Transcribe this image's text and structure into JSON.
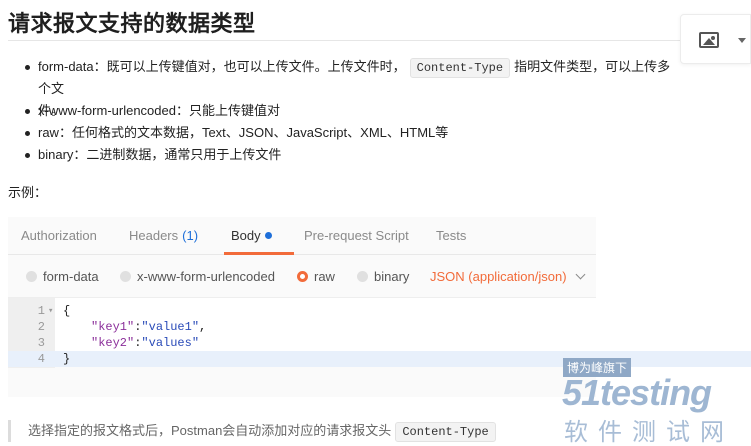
{
  "heading": "请求报文支持的数据类型",
  "bullets": {
    "b1_text1": "form-data：既可以上传键值对，也可以上传文件。上传文件时，",
    "b1_code": "Content-Type",
    "b1_text2": "指明文件类型，可以上传多个文",
    "b1_text3": "件。",
    "b2": "x-www-form-urlencoded：只能上传键值对",
    "b3": "raw：任何格式的文本数据，Text、JSON、JavaScript、XML、HTML等",
    "b4": "binary：二进制数据，通常只用于上传文件"
  },
  "example_label": "示例：",
  "postman": {
    "tabs": {
      "authorization": "Authorization",
      "headers": "Headers",
      "headers_count": "(1)",
      "body": "Body",
      "prerequest": "Pre-request Script",
      "tests": "Tests"
    },
    "body_types": {
      "form_data": "form-data",
      "urlencoded": "x-www-form-urlencoded",
      "raw": "raw",
      "binary": "binary"
    },
    "content_type": "JSON (application/json)",
    "editor": {
      "ln1": "1",
      "ln2": "2",
      "ln3": "3",
      "ln4": "4",
      "l1": "{",
      "l2_key": "\"key1\"",
      "l2_colon": ":",
      "l2_val": "\"value1\"",
      "l2_tail": ",",
      "l3_key": "\"key2\"",
      "l3_colon": ":",
      "l3_val": "\"values\"",
      "l4": "}"
    }
  },
  "note": {
    "text": "选择指定的报文格式后，Postman会自动添加对应的请求报文头",
    "code": "Content-Type"
  },
  "watermark": {
    "tag": "博为峰旗下",
    "brand": "51testing",
    "cn": "软件测试网"
  },
  "colors": {
    "accent": "#f26b3a",
    "link": "#1e6fd9"
  },
  "icons": {
    "image_tool": "image-icon",
    "dropdown": "chevron-down-icon"
  }
}
